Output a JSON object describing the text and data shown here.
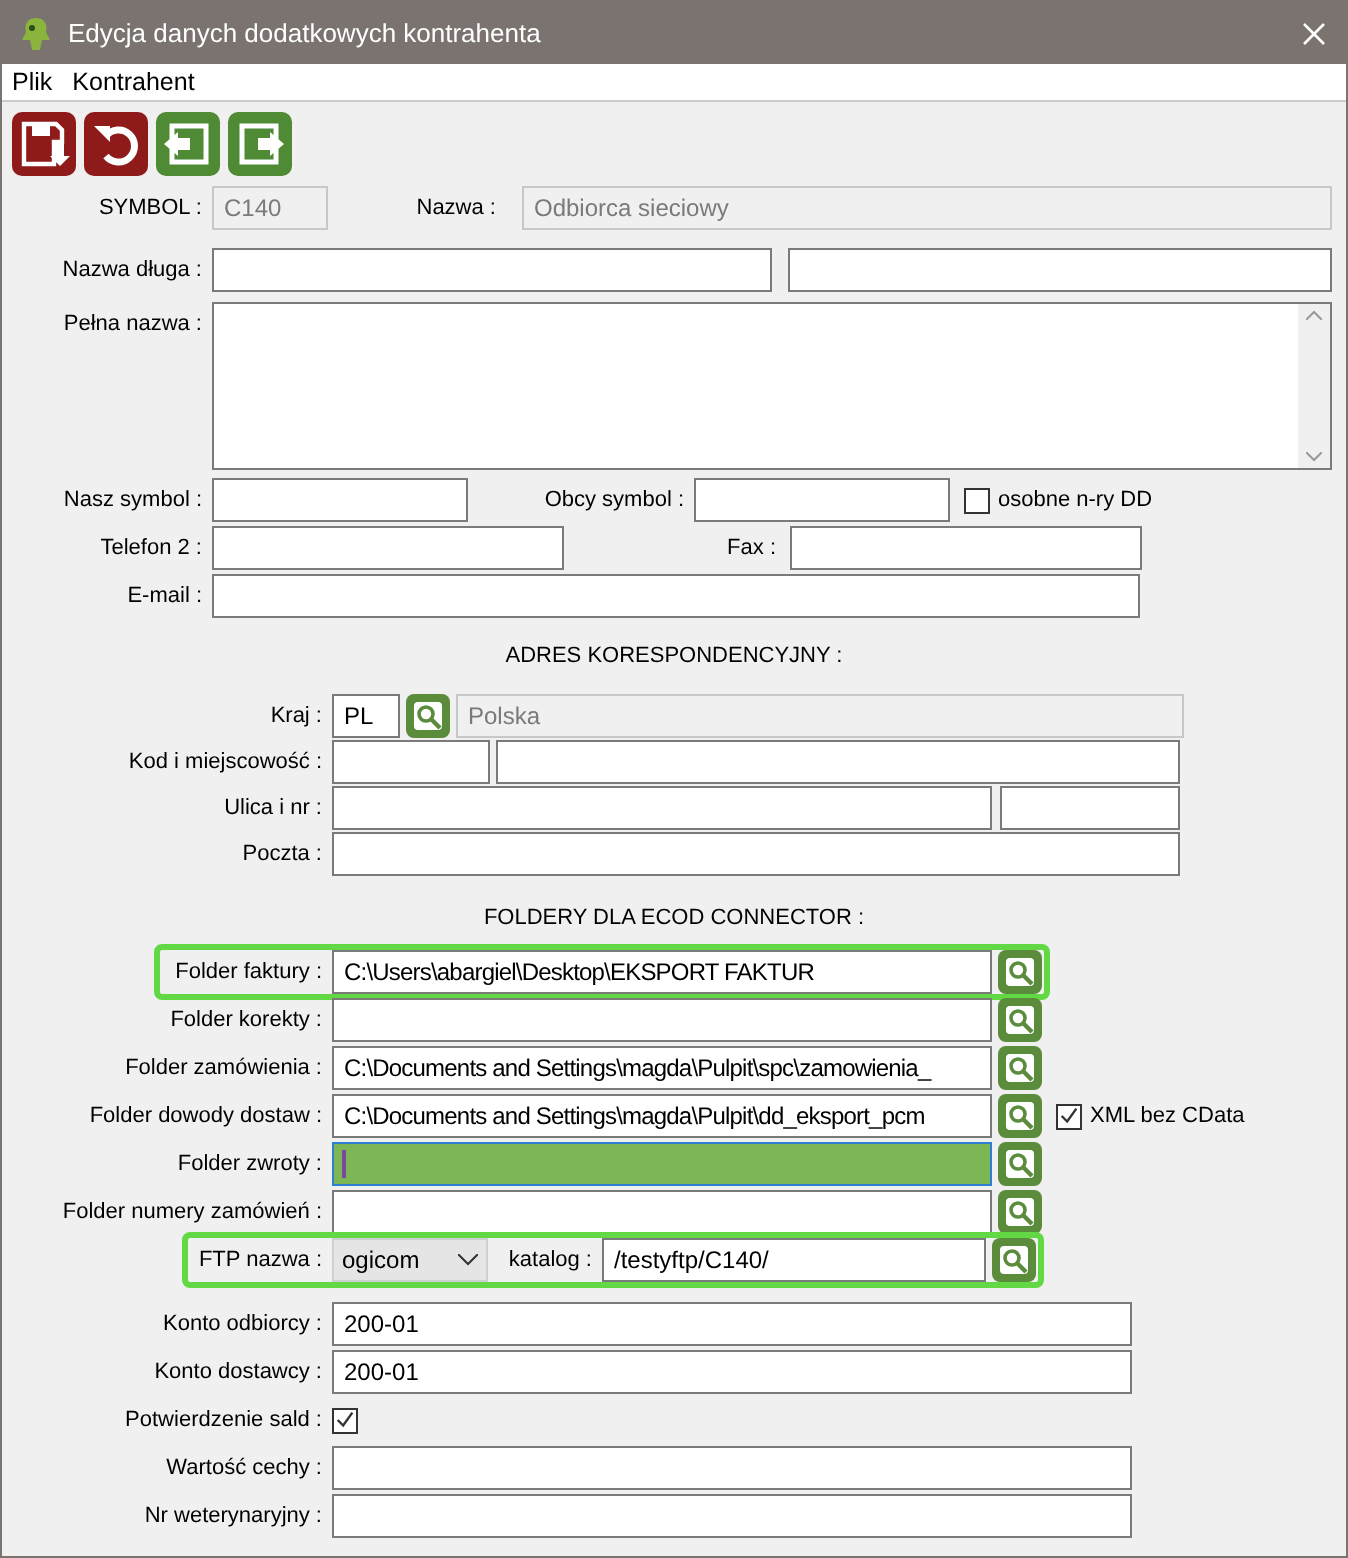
{
  "window": {
    "title": "Edycja danych dodatkowych kontrahenta"
  },
  "menu": [
    {
      "label": "Plik"
    },
    {
      "label": "Kontrahent"
    }
  ],
  "general": {
    "symbol": {
      "label": "SYMBOL :",
      "value": "C140",
      "disabled": true
    },
    "nazwa": {
      "label": "Nazwa :",
      "value": "Odbiorca sieciowy",
      "disabled": true
    },
    "nazwa_dluga": {
      "label": "Nazwa długa :"
    },
    "pelna_nazwa": {
      "label": "Pełna nazwa :"
    },
    "nasz_symbol": {
      "label": "Nasz symbol :"
    },
    "obcy_symbol": {
      "label": "Obcy symbol :"
    },
    "osobne": {
      "label": "osobne n-ry DD",
      "checked": false
    },
    "telefon2": {
      "label": "Telefon 2 :"
    },
    "fax": {
      "label": "Fax :"
    },
    "email": {
      "label": "E-mail :"
    }
  },
  "address": {
    "heading": "ADRES KORESPONDENCYJNY :",
    "kraj": {
      "label": "Kraj :",
      "code": "PL",
      "name": "Polska"
    },
    "kod": {
      "label": "Kod i miejscowość :"
    },
    "ulica": {
      "label": "Ulica i nr :"
    },
    "poczta": {
      "label": "Poczta :"
    }
  },
  "folders": {
    "heading": "FOLDERY DLA ECOD CONNECTOR :",
    "rows": [
      {
        "label": "Folder faktury :",
        "value": "C:\\Users\\abargiel\\Desktop\\EKSPORT FAKTUR",
        "highlighted": true,
        "focused": false
      },
      {
        "label": "Folder korekty :",
        "highlighted": false,
        "focused": false
      },
      {
        "label": "Folder zamówienia :",
        "value": "C:\\Documents and Settings\\magda\\Pulpit\\spc\\zamowienia_",
        "highlighted": false,
        "focused": false
      },
      {
        "label": "Folder dowody dostaw :",
        "value": "C:\\Documents and Settings\\magda\\Pulpit\\dd_eksport_pcm",
        "highlighted": false,
        "focused": false,
        "option": {
          "label": "XML bez CData",
          "checked": true
        }
      },
      {
        "label": "Folder zwroty :",
        "highlighted": false,
        "focused": true
      },
      {
        "label": "Folder numery zamówień :",
        "highlighted": false,
        "focused": false
      }
    ],
    "ftp": {
      "label": "FTP nazwa :",
      "server": "ogicom",
      "catalog_label": "katalog :",
      "catalog": "/testyftp/C140/",
      "highlighted": true
    }
  },
  "accounts": [
    {
      "kind": "field",
      "label": "Konto odbiorcy :",
      "value": "200-01"
    },
    {
      "kind": "field",
      "label": "Konto dostawcy :",
      "value": "200-01"
    },
    {
      "kind": "checkbox",
      "label": "Potwierdzenie sald :",
      "checked": true
    },
    {
      "kind": "field",
      "label": "Wartość cechy :"
    },
    {
      "kind": "field",
      "label": "Nr weterynaryjny :"
    }
  ]
}
